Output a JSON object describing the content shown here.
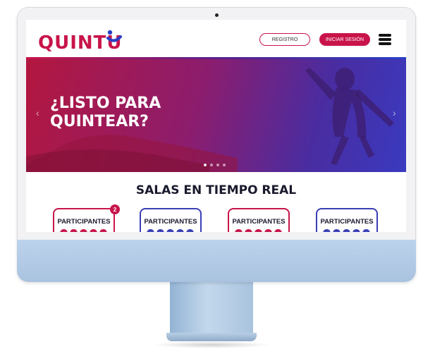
{
  "header": {
    "logo_text": "QUINTU",
    "register_label": "REGISTRO",
    "login_label": "INICIAR SESIÓN",
    "menu_icon": "hamburger-menu-icon"
  },
  "hero": {
    "title": "¿LISTO PARA\nQUINTEAR?",
    "prev_glyph": "‹",
    "next_glyph": "›",
    "slide_count": 4,
    "active_slide": 1
  },
  "rooms": {
    "title": "SALAS EN TIEMPO REAL",
    "cards": [
      {
        "label": "PARTICIPANTES",
        "badge": "2"
      },
      {
        "label": "PARTICIPANTES",
        "badge": ""
      },
      {
        "label": "PARTICIPANTES",
        "badge": ""
      },
      {
        "label": "PARTICIPANTES",
        "badge": ""
      }
    ]
  },
  "colors": {
    "brand": "#c8144a",
    "accent_blue": "#3a3fb5"
  }
}
